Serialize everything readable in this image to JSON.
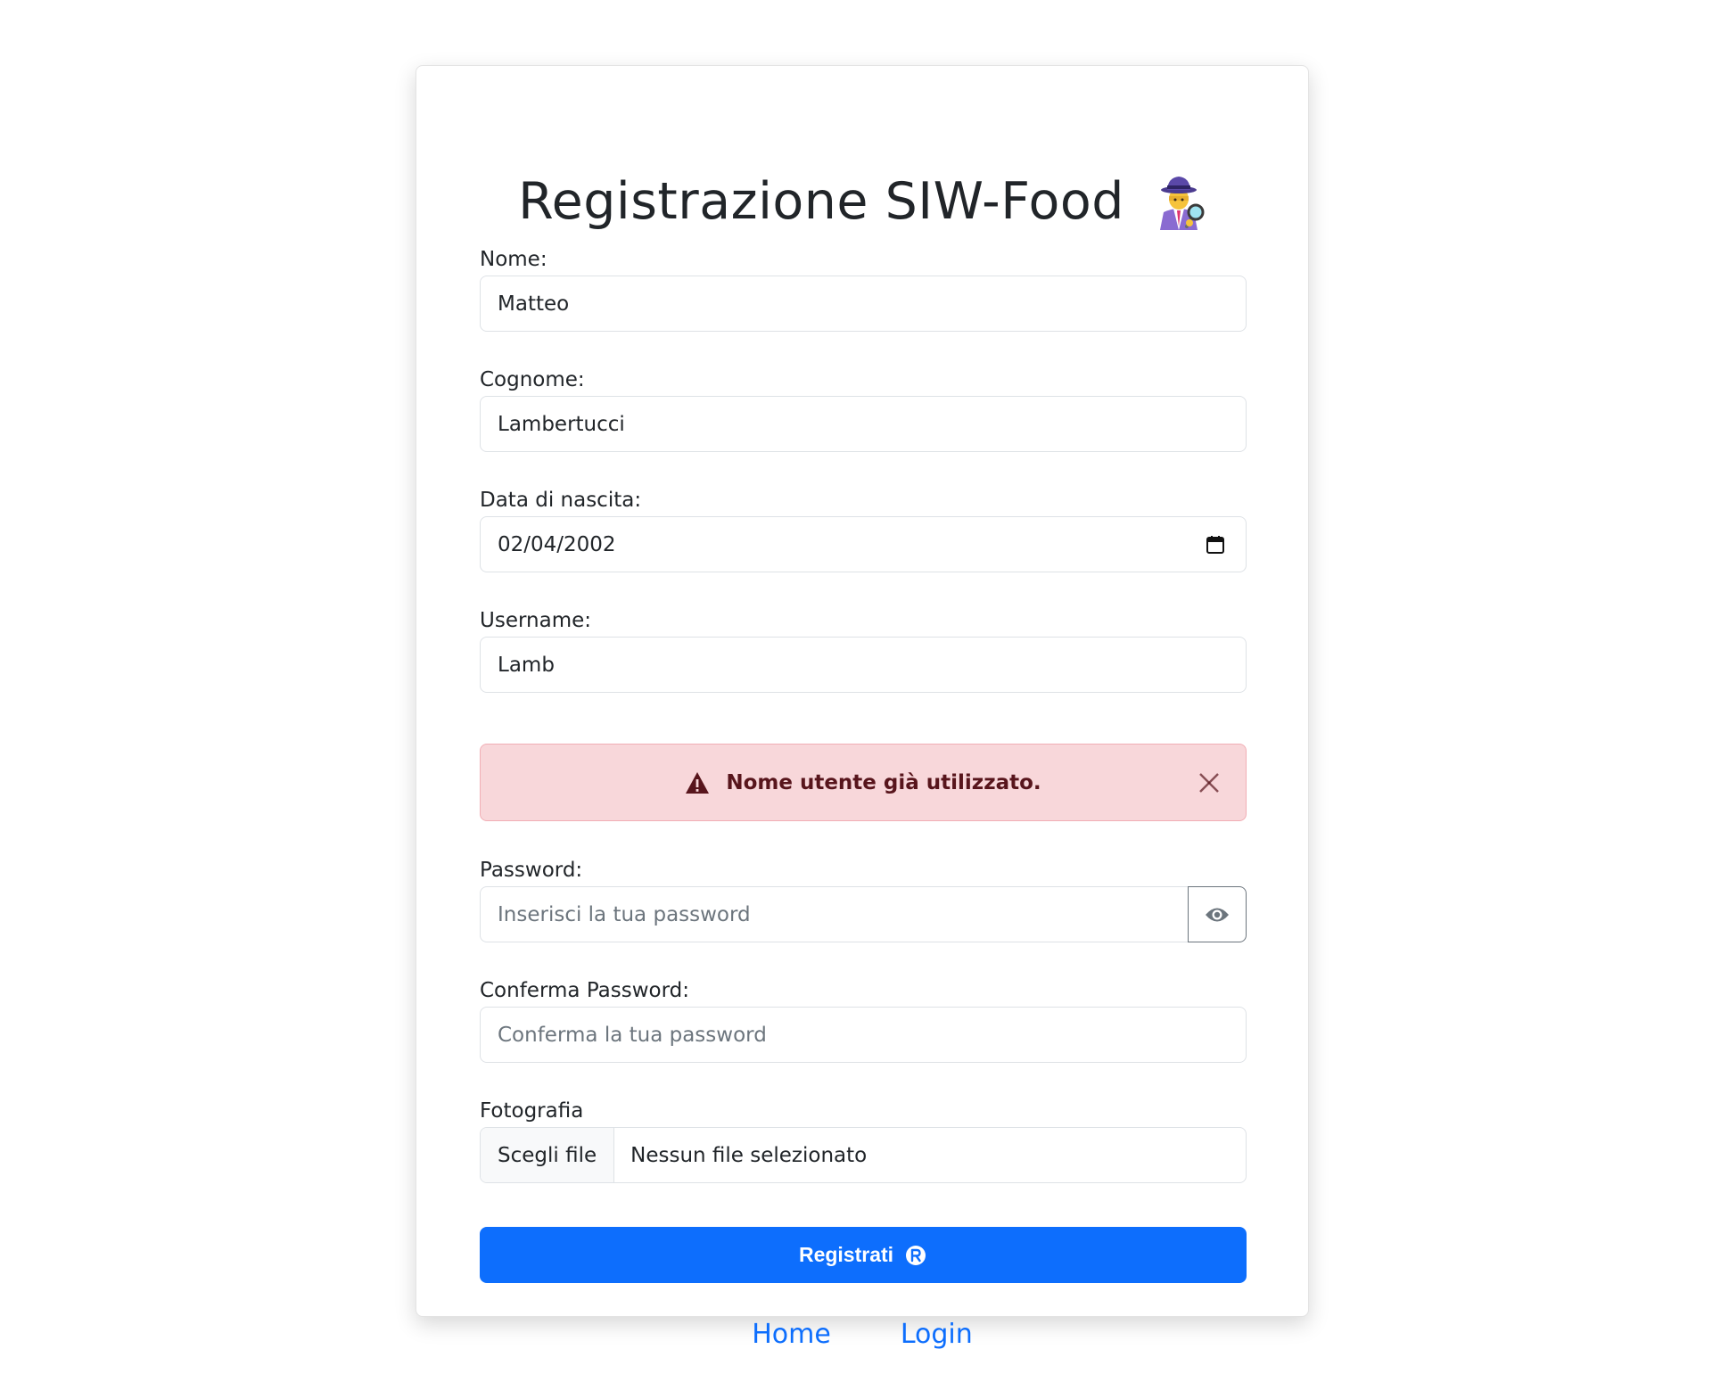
{
  "title": "Registrazione SIW-Food",
  "title_emoji": "detective-icon",
  "form": {
    "nome": {
      "label": "Nome:",
      "value": "Matteo"
    },
    "cognome": {
      "label": "Cognome:",
      "value": "Lambertucci"
    },
    "data_nascita": {
      "label": "Data di nascita:",
      "value": "02/04/2002"
    },
    "username": {
      "label": "Username:",
      "value": "Lamb"
    },
    "username_error": "Nome utente già utilizzato.",
    "password": {
      "label": "Password:",
      "placeholder": "Inserisci la tua password"
    },
    "conferma_password": {
      "label": "Conferma Password:",
      "placeholder": "Conferma la tua password"
    },
    "fotografia": {
      "label": "Fotografia",
      "button": "Scegli file",
      "status": "Nessun file selezionato"
    },
    "submit_label": "Registrati"
  },
  "links": {
    "home": "Home",
    "login": "Login"
  },
  "colors": {
    "primary": "#0d6efd",
    "alert_bg": "#f8d7da",
    "alert_text": "#58151c"
  }
}
